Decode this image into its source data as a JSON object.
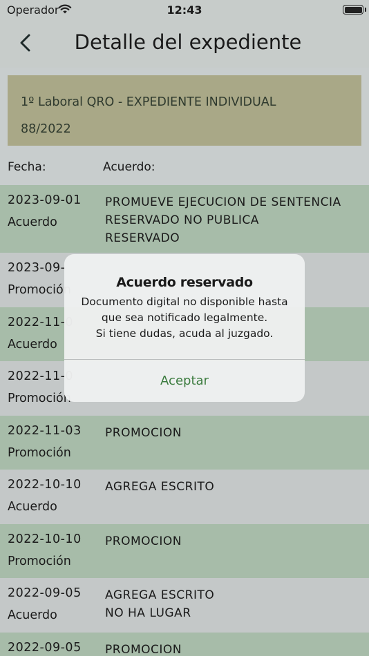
{
  "status_bar": {
    "carrier": "Operador",
    "time": "12:43"
  },
  "nav": {
    "title": "Detalle del expediente"
  },
  "case": {
    "line1": "1º Laboral QRO - EXPEDIENTE INDIVIDUAL",
    "line2": "88/2022"
  },
  "headers": {
    "fecha": "Fecha:",
    "acuerdo": "Acuerdo:"
  },
  "rows": [
    {
      "date": "2023-09-01",
      "type": "Acuerdo",
      "desc": [
        "PROMUEVE EJECUCION DE SENTENCIA",
        "RESERVADO NO PUBLICA",
        "RESERVADO"
      ]
    },
    {
      "date": "2023-09-",
      "type": "Promoción",
      "desc": []
    },
    {
      "date": "2022-11-0",
      "type": "Acuerdo",
      "desc": []
    },
    {
      "date": "2022-11-0",
      "type": "Promoción",
      "desc": []
    },
    {
      "date": "2022-11-03",
      "type": "Promoción",
      "desc": [
        "PROMOCION"
      ]
    },
    {
      "date": "2022-10-10",
      "type": "Acuerdo",
      "desc": [
        "AGREGA ESCRITO"
      ]
    },
    {
      "date": "2022-10-10",
      "type": "Promoción",
      "desc": [
        "PROMOCION"
      ]
    },
    {
      "date": "2022-09-05",
      "type": "Acuerdo",
      "desc": [
        "AGREGA ESCRITO",
        "NO HA LUGAR"
      ]
    },
    {
      "date": "2022-09-05",
      "type": "",
      "desc": [
        "PROMOCION"
      ]
    }
  ],
  "alert": {
    "title": "Acuerdo reservado",
    "message": [
      "Documento digital no disponible hasta",
      "que sea notificado legalmente.",
      "Si tiene dudas, acuda al juzgado."
    ],
    "button": "Aceptar"
  },
  "colors": {
    "accent": "#3b7b3e",
    "row_green": "#a7bca9",
    "row_gray": "#c4c8c8",
    "card": "#a9a887"
  }
}
